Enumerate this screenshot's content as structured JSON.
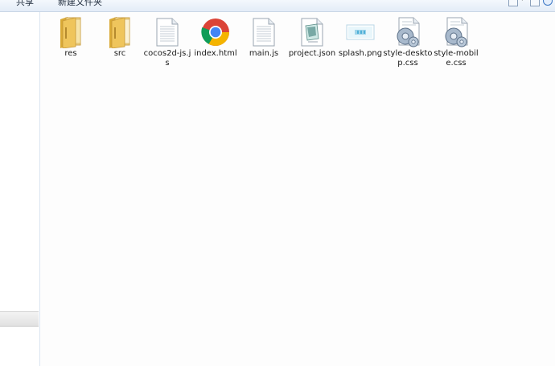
{
  "toolbar": {
    "share_label": "共享",
    "new_folder_label": "新建文件夹"
  },
  "files": [
    {
      "name": "res",
      "icon": "folder-icon"
    },
    {
      "name": "src",
      "icon": "folder-icon"
    },
    {
      "name": "cocos2d-js.js",
      "icon": "js-file-icon"
    },
    {
      "name": "index.html",
      "icon": "chrome-html-icon"
    },
    {
      "name": "main.js",
      "icon": "js-file-icon"
    },
    {
      "name": "project.json",
      "icon": "json-file-icon"
    },
    {
      "name": "splash.png",
      "icon": "png-file-icon"
    },
    {
      "name": "style-desktop.css",
      "icon": "css-file-icon"
    },
    {
      "name": "style-mobile.css",
      "icon": "css-file-icon"
    }
  ],
  "colors": {
    "folder": "#e9c25a",
    "chrome_red": "#db4437",
    "chrome_green": "#0f9d58",
    "chrome_yellow": "#f4b400",
    "chrome_blue": "#4285f4"
  }
}
